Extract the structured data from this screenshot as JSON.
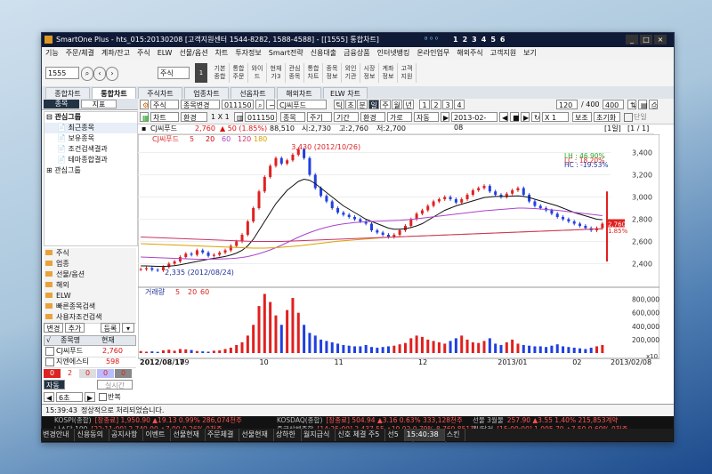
{
  "title": "SmartOne Plus - hts_015:20130208 [고객지원센터 1544-8282, 1588-4588] - [[1555] 통합차트]",
  "window_buttons": [
    "_",
    "□",
    "×"
  ],
  "menu": [
    "기능",
    "주문/체결",
    "계좌/잔고",
    "주식",
    "ELW",
    "선물/옵션",
    "차트",
    "투자정보",
    "Smart전략",
    "신용대출",
    "금융상품",
    "인터넷뱅킹",
    "온라인업무",
    "해외주식",
    "고객지원",
    "보기"
  ],
  "numbar": [
    "1",
    "2",
    "3",
    "4",
    "5",
    "6"
  ],
  "toolbar": {
    "screen_no": "1555",
    "type_select": "주식",
    "buttons": [
      "기본\n종합",
      "통합\n주문",
      "와이\n드",
      "현재\n가3",
      "관심\n종목",
      "통합\n차트",
      "종목\n정보",
      "외인\n기관",
      "시장\n정보",
      "계좌\n정보",
      "고객\n지원"
    ]
  },
  "tabs": [
    "종합차트",
    "통합차트",
    "주식차트",
    "업종차트",
    "선옵차트",
    "해외차트",
    "ELW 차트"
  ],
  "active_tab": 1,
  "left_panel": {
    "tabs": [
      "종목",
      "지표"
    ],
    "tree_header": "관심그룹",
    "tree_items": [
      "최근종목",
      "보유종목",
      "조건검색결과",
      "테마종합결과",
      "관심그룹"
    ],
    "folders": [
      "주식",
      "업종",
      "선물/옵션",
      "해외",
      "ELW",
      "빠른종목검색",
      "사용자조건검색"
    ],
    "watch_buttons": [
      "변경",
      "추가",
      "등록"
    ],
    "watch_headers": [
      "종목명",
      "현재"
    ],
    "watch_rows": [
      {
        "name": "CJ씨푸드",
        "price": "2,760"
      },
      {
        "name": "지엔에스티",
        "price": "598"
      }
    ],
    "counts": [
      "0",
      "2",
      "0",
      "0",
      "0"
    ],
    "auto": "자동",
    "interval": "6초",
    "live": "실시간",
    "repeat": "반복"
  },
  "chart_toolbar": {
    "type": "주식",
    "mode": "종목변경",
    "code": "011150",
    "name": "CJ씨푸드",
    "periods": [
      "틱",
      "초",
      "분",
      "일",
      "주",
      "월",
      "년"
    ],
    "counts": [
      "1",
      "2",
      "3",
      "4"
    ],
    "interval": "120",
    "view": "/ 400",
    "view_count": "400",
    "row2": [
      "차트",
      "환경",
      "1 X 1"
    ],
    "code2": "011150",
    "btns2": [
      "종목",
      "주기",
      "기간",
      "환경",
      "가로",
      "자동"
    ],
    "date": "2013-02-08",
    "multiplier": "X 1",
    "save": "보조",
    "reset": "초기화",
    "single": "단일"
  },
  "chart_header": {
    "name": "CJ씨푸드",
    "price": "2,760",
    "change": "▲ 50 (1.85%)",
    "volume": "88,510",
    "open": "시:2,730",
    "high": "고:2,760",
    "low": "저:2,700",
    "page": "[1일]",
    "pages": "[1 / 1]"
  },
  "price_legend": [
    "CJ씨푸드",
    "5",
    "20",
    "60",
    "120",
    "180"
  ],
  "vol_legend": [
    "거래량",
    "5",
    "20",
    "60"
  ],
  "stats": {
    "lh": "LH : 46.90%",
    "lc": "LC : 18.20%",
    "hc": "HC : -19.53%"
  },
  "annot_high": "3,430 (2012/10/26)",
  "annot_low": "2,335 (2012/08/24)",
  "price_axis": [
    "3,400",
    "3,200",
    "3,000",
    "2,800",
    "2,600",
    "2,400"
  ],
  "price_tags": [
    "2,760",
    "1.85%"
  ],
  "vol_axis": [
    "800,000",
    "600,000",
    "400,000",
    "200,000",
    "x10"
  ],
  "date_left": "2012/08/17",
  "date_right": "2013/02/08",
  "x_ticks": [
    "09",
    "10",
    "11",
    "12",
    "2013/01",
    "02"
  ],
  "tools": [
    "확대",
    "축소",
    "도구",
    "지우",
    "지표",
    "비교",
    "설정"
  ],
  "status_bar": {
    "time": "15:39:43",
    "message": "정상적으로 처리되었습니다."
  },
  "ticker": {
    "rows": [
      {
        "label": "KOSPI(종합)",
        "text": "[장종료] 1,950.90 ▲19.13 0.99% 286,074천주"
      },
      {
        "label": "KOSDAQ(종합)",
        "text": "[장종료] 504.94 ▲3.16 0.63% 333,128천주"
      },
      {
        "label": "선물 3월물",
        "text": "257.90 ▲3.55 1.40% 215,853계약"
      },
      {
        "label": "나스닥 100",
        "text": "[22:11:00] 2,749.00 ▲7.00 0.26% 0천주"
      },
      {
        "label": "중국상해종합",
        "text": "[14:25:00] 2,437.55 ▲19.02 0.79% 8,769,851천"
      },
      {
        "label": "원/달러",
        "text": "[15:00:00] 1,095.70 ▲7.50 0.69% 0천주"
      },
      {
        "label": "코스닥투자",
        "text": "4  575  110  314  0"
      },
      {
        "label": "이데일리",
        "text": "[15:40:15] 파인디지털, 설 연휴 임시 계좌 도로 정보 제공"
      }
    ]
  },
  "taskbar": [
    "변경안내",
    "신용동의",
    "공지사항",
    "이벤트",
    "선물현재",
    "주문체결",
    "선물현재",
    "상하한",
    "월지급식",
    "신호 체결 주5",
    "선5"
  ],
  "clock": "15:40:38",
  "corner": "스킨",
  "chart_data": {
    "type": "candlestick",
    "x_range": [
      "2012-08-17",
      "2013-02-08"
    ],
    "ylim": [
      2300,
      3500
    ],
    "series": [
      {
        "name": "price_close_approx",
        "values": [
          2350,
          2360,
          2345,
          2340,
          2370,
          2400,
          2420,
          2460,
          2490,
          2480,
          2520,
          2500,
          2470,
          2480,
          2500,
          2520,
          2560,
          2600,
          2660,
          2780,
          2900,
          3050,
          3180,
          3280,
          3350,
          3300,
          3330,
          3380,
          3430,
          3350,
          3200,
          3080,
          3010,
          2960,
          2900,
          2860,
          2840,
          2820,
          2800,
          2780,
          2760,
          2700,
          2680,
          2660,
          2640,
          2660,
          2700,
          2740,
          2800,
          2850,
          2880,
          2920,
          2960,
          2980,
          3000,
          2980,
          2950,
          2980,
          3020,
          3060,
          3080,
          3100,
          3050,
          3020,
          3000,
          3030,
          3060,
          3080,
          3020,
          2960,
          2920,
          2900,
          2880,
          2850,
          2820,
          2800,
          2780,
          2760,
          2740,
          2720,
          2700,
          2720,
          2760
        ]
      },
      {
        "name": "MA_20",
        "values": [
          2380,
          2380,
          2378,
          2376,
          2375,
          2378,
          2382,
          2390,
          2400,
          2410,
          2420,
          2430,
          2440,
          2448,
          2456,
          2465,
          2478,
          2495,
          2520,
          2560,
          2620,
          2700,
          2780,
          2860,
          2940,
          3000,
          3060,
          3100,
          3140,
          3160,
          3150,
          3120,
          3080,
          3040,
          3000,
          2960,
          2920,
          2890,
          2860,
          2830,
          2800,
          2780,
          2760,
          2740,
          2720,
          2710,
          2710,
          2715,
          2725,
          2740,
          2760,
          2790,
          2820,
          2850,
          2880,
          2900,
          2920,
          2935,
          2950,
          2965,
          2980,
          2995,
          3000,
          3005,
          3005,
          3005,
          3008,
          3010,
          3005,
          2995,
          2980,
          2965,
          2950,
          2935,
          2920,
          2900,
          2880,
          2860,
          2845,
          2830,
          2815,
          2800,
          2795
        ]
      },
      {
        "name": "MA_60",
        "values": [
          2460,
          2458,
          2456,
          2454,
          2452,
          2450,
          2448,
          2446,
          2444,
          2442,
          2440,
          2440,
          2440,
          2441,
          2442,
          2444,
          2446,
          2450,
          2456,
          2464,
          2476,
          2490,
          2506,
          2524,
          2544,
          2566,
          2590,
          2614,
          2638,
          2660,
          2680,
          2698,
          2714,
          2728,
          2740,
          2750,
          2758,
          2764,
          2770,
          2774,
          2778,
          2780,
          2782,
          2784,
          2786,
          2788,
          2790,
          2794,
          2798,
          2804,
          2810,
          2816,
          2822,
          2828,
          2834,
          2840,
          2846,
          2852,
          2858,
          2864,
          2870,
          2876,
          2880,
          2884,
          2888,
          2892,
          2896,
          2900,
          2900,
          2898,
          2896,
          2892,
          2888,
          2884,
          2880,
          2874,
          2868,
          2862,
          2856,
          2850,
          2844,
          2838,
          2832
        ]
      },
      {
        "name": "MA_120",
        "values": [
          2580,
          2578,
          2576,
          2574,
          2572,
          2570,
          2568,
          2566,
          2564,
          2562,
          2560,
          2558,
          2556,
          2554,
          2552,
          2550,
          2548,
          2546,
          2544,
          2542,
          2540,
          2540,
          2540,
          2542,
          2544,
          2548,
          2552,
          2556,
          2560,
          2566,
          2572,
          2578,
          2584,
          2590,
          2596,
          2602,
          2606,
          2610,
          2614,
          2618,
          2622,
          2626,
          2630,
          2634,
          2638,
          2640,
          2642,
          2644,
          2646,
          2648,
          2650,
          2652,
          2654,
          2656,
          2658,
          2660,
          2662,
          2664,
          2666,
          2668,
          2670,
          2672,
          2674,
          2676,
          2678,
          2680,
          2682,
          2684,
          2686,
          2688,
          2690,
          2692,
          2694,
          2696,
          2698,
          2700,
          2702,
          2704,
          2706,
          2708,
          2710,
          2712,
          2714
        ]
      },
      {
        "name": "MA_180",
        "values": [
          2640,
          2638,
          2636,
          2634,
          2632,
          2630,
          2628,
          2626,
          2624,
          2622,
          2620,
          2618,
          2616,
          2614,
          2612,
          2610,
          2608,
          2606,
          2604,
          2602,
          2600,
          2600,
          2600,
          2600,
          2600,
          2600,
          2602,
          2604,
          2606,
          2608,
          2610,
          2612,
          2614,
          2616,
          2618,
          2620,
          2622,
          2624,
          2626,
          2628,
          2630,
          2632,
          2634,
          2636,
          2638,
          2640,
          2642,
          2644,
          2646,
          2648,
          2650,
          2652,
          2654,
          2656,
          2658,
          2660,
          2662,
          2664,
          2666,
          2668,
          2670,
          2672,
          2674,
          2676,
          2678,
          2680,
          2682,
          2684,
          2686,
          2688,
          2690,
          2692,
          2694,
          2696,
          2698,
          2700,
          2702,
          2704,
          2706,
          2708,
          2710,
          2712,
          2714
        ]
      }
    ],
    "volume": [
      30,
      20,
      25,
      18,
      40,
      50,
      35,
      60,
      55,
      45,
      30,
      25,
      20,
      35,
      40,
      60,
      80,
      120,
      160,
      260,
      420,
      700,
      880,
      760,
      560,
      420,
      640,
      820,
      600,
      420,
      300,
      260,
      200,
      180,
      160,
      140,
      120,
      110,
      100,
      100,
      120,
      90,
      80,
      90,
      100,
      110,
      130,
      150,
      220,
      260,
      240,
      200,
      180,
      160,
      140,
      180,
      220,
      260,
      200,
      160,
      150,
      180,
      220,
      140,
      120,
      160,
      200,
      140,
      120,
      110,
      100,
      100,
      90,
      110,
      130,
      100,
      90,
      80,
      70,
      60,
      80,
      100,
      120
    ],
    "vol_ylim": [
      0,
      900
    ]
  }
}
